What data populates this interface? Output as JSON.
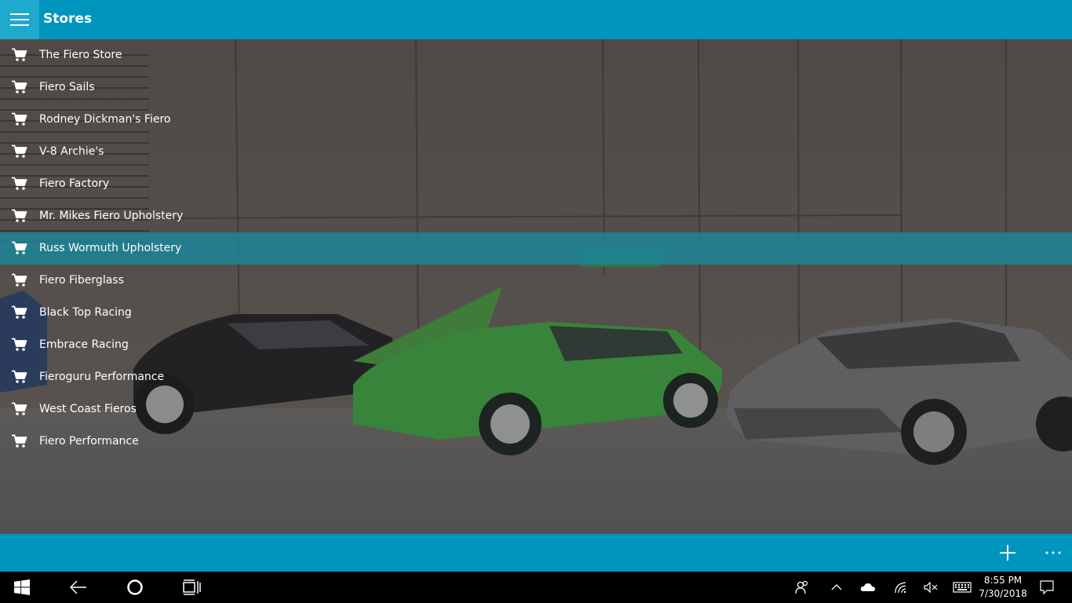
{
  "header": {
    "title": "Stores",
    "menu_icon": "hamburger-icon"
  },
  "stores": [
    {
      "name": "The Fiero Store",
      "icon": "cart-icon"
    },
    {
      "name": "Fiero Sails",
      "icon": "cart-icon"
    },
    {
      "name": "Rodney Dickman's Fiero",
      "icon": "cart-icon"
    },
    {
      "name": "V-8 Archie's",
      "icon": "cart-icon"
    },
    {
      "name": "Fiero Factory",
      "icon": "cart-icon"
    },
    {
      "name": "Mr. Mikes Fiero Upholstery",
      "icon": "cart-icon"
    },
    {
      "name": "Russ Wormuth Upholstery",
      "icon": "cart-icon",
      "selected": true
    },
    {
      "name": "Fiero Fiberglass",
      "icon": "cart-icon"
    },
    {
      "name": "Black Top Racing",
      "icon": "cart-icon"
    },
    {
      "name": "Embrace Racing",
      "icon": "cart-icon"
    },
    {
      "name": "Fieroguru Performance",
      "icon": "cart-icon"
    },
    {
      "name": "West Coast Fieros",
      "icon": "cart-icon"
    },
    {
      "name": "Fiero Performance",
      "icon": "cart-icon"
    }
  ],
  "command_bar": {
    "add_icon": "plus-icon",
    "more_icon": "ellipsis-icon"
  },
  "taskbar": {
    "start_icon": "windows-start-icon",
    "back_icon": "back-arrow-icon",
    "cortana_icon": "cortana-circle-icon",
    "task_view_icon": "task-view-icon",
    "people_icon": "people-icon",
    "chevron_icon": "chevron-up-icon",
    "onedrive_icon": "cloud-icon",
    "wifi_icon": "wifi-icon",
    "volume_icon": "volume-muted-icon",
    "keyboard_icon": "keyboard-icon",
    "notification_icon": "action-center-icon",
    "time": "8:55 PM",
    "date": "7/30/2018"
  },
  "colors": {
    "accent": "#0095bf",
    "hamburger_bg": "#1fa9cc",
    "selected_row": "#1c8598",
    "taskbar": "#000000"
  }
}
